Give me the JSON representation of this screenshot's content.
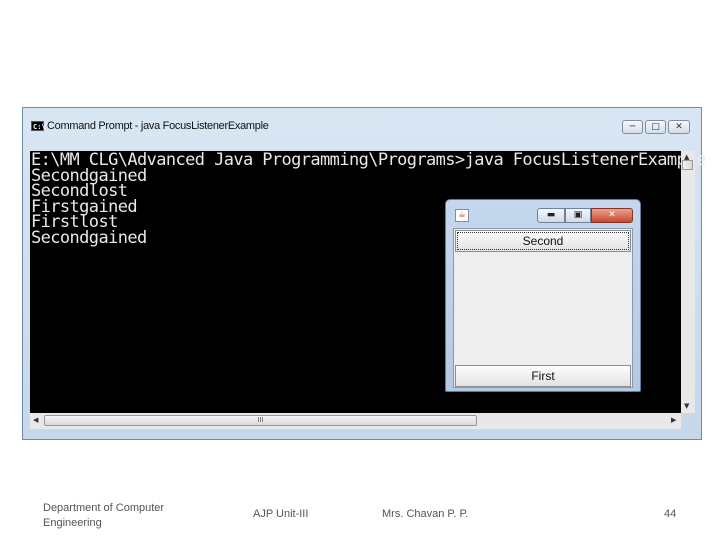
{
  "cmd_window": {
    "title": "Command Prompt - java  FocusListenerExample",
    "icon_text": "C:\\",
    "console_lines": [
      "E:\\MM CLG\\Advanced Java Programming\\Programs>java FocusListenerExample",
      "Secondgained",
      "Secondlost",
      "Firstgained",
      "Firstlost",
      "Secondgained"
    ],
    "hscroll_grip": "III"
  },
  "java_frame": {
    "buttons": {
      "second": "Second",
      "first": "First"
    }
  },
  "footer": {
    "department": "Department of Computer Engineering",
    "unit": "AJP Unit-III",
    "author": "Mrs. Chavan P. P.",
    "page": "44"
  }
}
